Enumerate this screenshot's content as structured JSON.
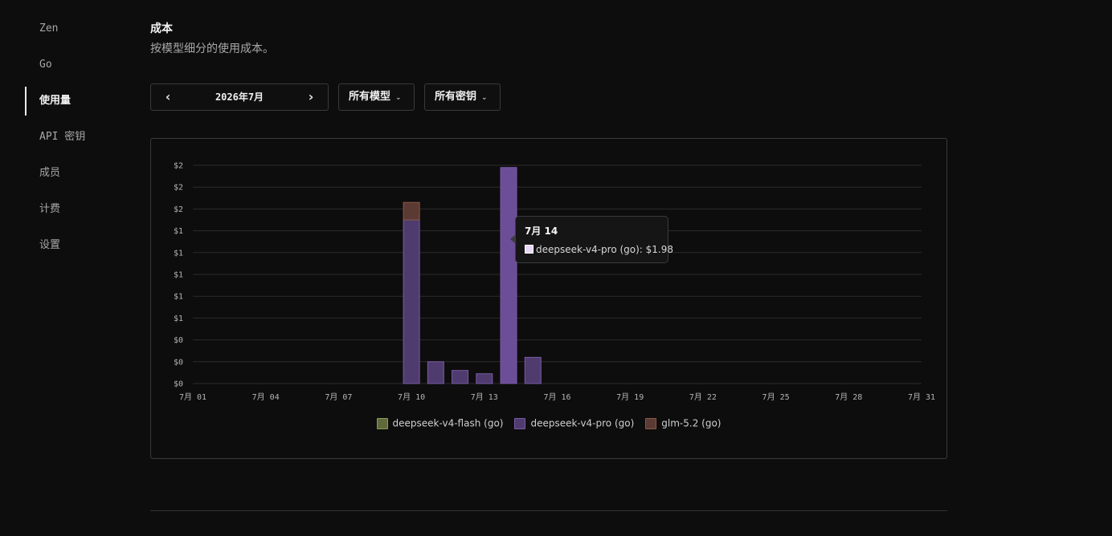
{
  "sidebar": {
    "items": [
      {
        "label": "Zen",
        "active": false
      },
      {
        "label": "Go",
        "active": false
      },
      {
        "label": "使用量",
        "active": true
      },
      {
        "label": "API 密钥",
        "active": false
      },
      {
        "label": "成员",
        "active": false
      },
      {
        "label": "计费",
        "active": false
      },
      {
        "label": "设置",
        "active": false
      }
    ]
  },
  "section": {
    "title": "成本",
    "subtitle": "按模型细分的使用成本。"
  },
  "controls": {
    "month_prev_icon": "chevron-left-icon",
    "month_label": "2026年7月",
    "month_next_icon": "chevron-right-icon",
    "model_filter": "所有模型",
    "key_filter": "所有密钥",
    "dropdown_icon": "chevron-down-icon"
  },
  "chart_data": {
    "type": "bar",
    "stacked": true,
    "days": 31,
    "x_tick_labels": [
      "7月 01",
      "7月 04",
      "7月 07",
      "7月 10",
      "7月 13",
      "7月 16",
      "7月 19",
      "7月 22",
      "7月 25",
      "7月 28",
      "7月 31"
    ],
    "x_tick_days": [
      1,
      4,
      7,
      10,
      13,
      16,
      19,
      22,
      25,
      28,
      31
    ],
    "y_tick_labels": [
      "$2",
      "$2",
      "$2",
      "$1",
      "$1",
      "$1",
      "$1",
      "$1",
      "$0",
      "$0",
      "$0"
    ],
    "y_tick_values": [
      2.0,
      1.8,
      1.6,
      1.4,
      1.2,
      1.0,
      0.8,
      0.6,
      0.4,
      0.2,
      0.0
    ],
    "ylim": [
      0,
      2.0
    ],
    "grid": true,
    "legend_position": "bottom",
    "series": [
      {
        "name": "deepseek-v4-flash (go)",
        "color": "#5e6a3a",
        "border": "#8e9a55",
        "points": []
      },
      {
        "name": "deepseek-v4-pro (go)",
        "color": "#4f3b6e",
        "border": "#7a5aa6",
        "points": [
          {
            "day": 10,
            "value": 1.5
          },
          {
            "day": 11,
            "value": 0.2
          },
          {
            "day": 12,
            "value": 0.12
          },
          {
            "day": 13,
            "value": 0.09
          },
          {
            "day": 14,
            "value": 1.98
          },
          {
            "day": 15,
            "value": 0.24
          }
        ]
      },
      {
        "name": "glm-5.2 (go)",
        "color": "#5a3a33",
        "border": "#8c5848",
        "points": [
          {
            "day": 10,
            "value": 0.16
          }
        ]
      }
    ],
    "highlight": {
      "day": 14,
      "series": 1,
      "color": "#6c4d98"
    }
  },
  "tooltip": {
    "title": "7月 14",
    "swatch_color": "#e7d7f7",
    "text": "deepseek-v4-pro (go): $1.98"
  }
}
